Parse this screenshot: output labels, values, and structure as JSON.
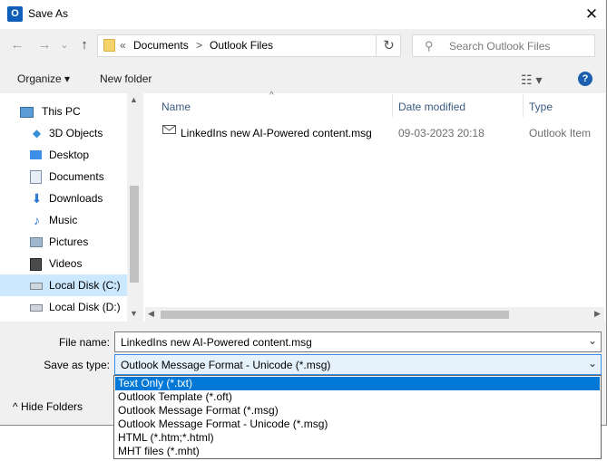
{
  "window": {
    "title": "Save As",
    "app_icon": "O",
    "close_glyph": "✕"
  },
  "navigation": {
    "back": "←",
    "forward": "→",
    "dropdown": "⌄",
    "up": "↑"
  },
  "address": {
    "overflow": "«",
    "crumbs": [
      "Documents",
      "Outlook Files"
    ],
    "separator": ">",
    "refresh": "↻"
  },
  "search": {
    "placeholder": "Search Outlook Files",
    "icon": "⚲"
  },
  "toolbar": {
    "organize": "Organize ▾",
    "new_folder": "New folder",
    "view_glyph": "☷ ▾",
    "help": "?"
  },
  "sidebar": {
    "items": [
      {
        "label": "This PC",
        "icon": "pc-icon"
      },
      {
        "label": "3D Objects",
        "icon": "3d-objects-icon"
      },
      {
        "label": "Desktop",
        "icon": "desktop-icon"
      },
      {
        "label": "Documents",
        "icon": "documents-icon"
      },
      {
        "label": "Downloads",
        "icon": "downloads-icon"
      },
      {
        "label": "Music",
        "icon": "music-icon"
      },
      {
        "label": "Pictures",
        "icon": "pictures-icon"
      },
      {
        "label": "Videos",
        "icon": "videos-icon"
      },
      {
        "label": "Local Disk (C:)",
        "icon": "drive-icon",
        "selected": true
      },
      {
        "label": "Local Disk (D:)",
        "icon": "drive-icon"
      }
    ]
  },
  "file_list": {
    "columns": [
      "Name",
      "Date modified",
      "Type"
    ],
    "sort_indicator": "^",
    "files": [
      {
        "name": "LinkedIns new AI-Powered content.msg",
        "date": "09-03-2023 20:18",
        "type": "Outlook Item",
        "icon": "mail-icon"
      }
    ]
  },
  "form": {
    "file_name_label": "File name:",
    "file_name_value": "LinkedIns new AI-Powered content.msg",
    "save_type_label": "Save as type:",
    "save_type_value": "Outlook Message Format - Unicode (*.msg)"
  },
  "dropdown_options": [
    "Text Only (*.txt)",
    "Outlook Template (*.oft)",
    "Outlook Message Format (*.msg)",
    "Outlook Message Format - Unicode (*.msg)",
    "HTML (*.htm;*.html)",
    "MHT files (*.mht)"
  ],
  "highlighted_option_index": 0,
  "hide_folders": "^ Hide Folders",
  "colors": {
    "accent": "#0078d7",
    "selection": "#cce8ff",
    "background": "#f0f0f0"
  }
}
